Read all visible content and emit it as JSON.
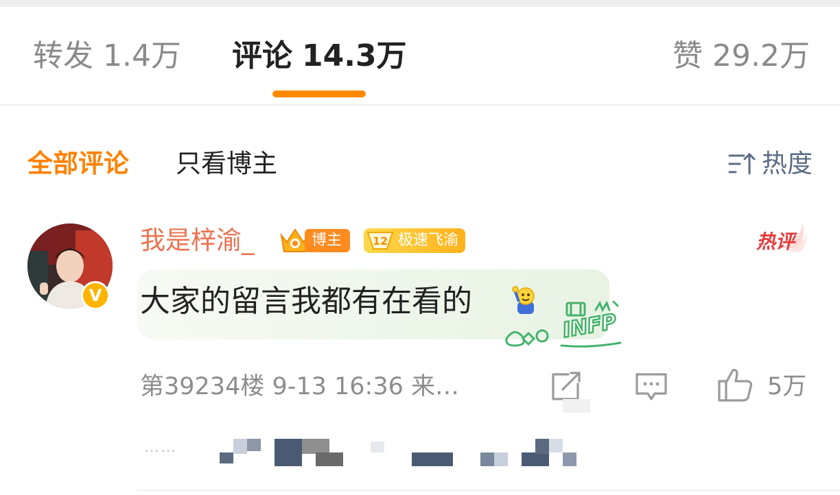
{
  "tabs": {
    "repost": {
      "label": "转发",
      "count": "1.4万"
    },
    "comments": {
      "label": "评论",
      "count": "14.3万"
    },
    "likes": {
      "label": "赞",
      "count": "29.2万"
    }
  },
  "filter": {
    "all_label": "全部评论",
    "host_only_label": "只看博主",
    "sort_label": "热度"
  },
  "comment": {
    "username": "我是梓渝_",
    "host_badge": "博主",
    "fan_badge": {
      "level": "12",
      "label": "极速飞渝"
    },
    "hot_tag": "热评",
    "text": "大家的留言我都有在看的",
    "emoji_icon": "waving-person-emoji",
    "sticker_text": "INFP",
    "meta": "第39234楼 9-13 16:36 来…",
    "like_count": "5万"
  },
  "reply_preview": {
    "prefix": "……"
  },
  "colors": {
    "accent": "#ff8200",
    "username": "#eb7350",
    "sort": "#5a6c84",
    "hot": "#e33c3c"
  }
}
